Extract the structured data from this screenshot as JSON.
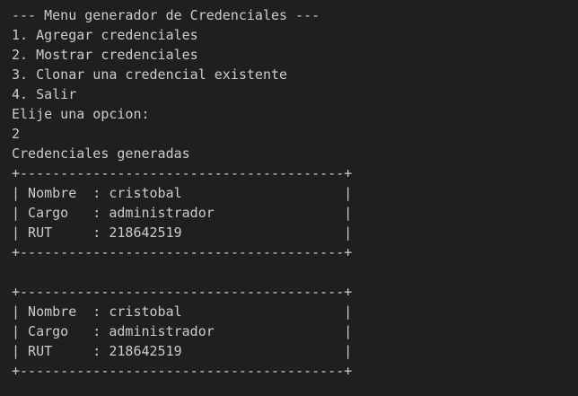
{
  "terminal": {
    "colors": {
      "background": "#1f1f1f",
      "foreground": "#cccccc"
    },
    "lines": [
      "--- Menu generador de Credenciales ---",
      "1. Agregar credenciales",
      "2. Mostrar credenciales",
      "3. Clonar una credencial existente",
      "4. Salir",
      "Elije una opcion:",
      "2",
      "Credenciales generadas",
      "+----------------------------------------+",
      "| Nombre  : cristobal                    |",
      "| Cargo   : administrador                |",
      "| RUT     : 218642519                    |",
      "+----------------------------------------+",
      "",
      "+----------------------------------------+",
      "| Nombre  : cristobal                    |",
      "| Cargo   : administrador                |",
      "| RUT     : 218642519                    |",
      "+----------------------------------------+"
    ]
  }
}
